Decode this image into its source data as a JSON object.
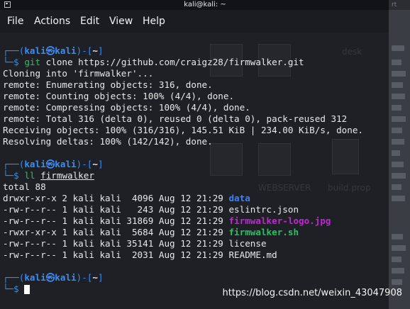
{
  "window": {
    "title": "kali@kali: ~",
    "side_fragment": "rt"
  },
  "menu": {
    "items": [
      "File",
      "Actions",
      "Edit",
      "View",
      "Help"
    ]
  },
  "background_labels": {
    "webserver": "WEBSERVER",
    "build": "build.prop",
    "desk": "desk"
  },
  "prompt": {
    "frame_open": "┌──(",
    "user": "kali",
    "at": "㉿",
    "host": "kali",
    "frame_mid": ")-[",
    "dir": "~",
    "frame_close": "]",
    "frame_bottom": "└─",
    "dollar": "$ "
  },
  "session": {
    "cmd1_verb": "git",
    "cmd1_args": " clone https://github.com/craigz28/firmwalker.git",
    "clone_output": [
      "Cloning into 'firmwalker'...",
      "remote: Enumerating objects: 316, done.",
      "remote: Counting objects: 100% (4/4), done.",
      "remote: Compressing objects: 100% (4/4), done.",
      "remote: Total 316 (delta 0), reused 0 (delta 0), pack-reused 312",
      "Receiving objects: 100% (316/316), 145.51 KiB | 234.00 KiB/s, done.",
      "Resolving deltas: 100% (142/142), done."
    ],
    "cmd2_verb": "ll",
    "cmd2_arg": "firmwalker",
    "total": "total 88",
    "ls_rows": [
      {
        "meta": "drwxr-xr-x 2 kali kali  4096 Aug 12 21:29 ",
        "name": "data",
        "kind": "dir"
      },
      {
        "meta": "-rw-r--r-- 1 kali kali   243 Aug 12 21:29 ",
        "name": "eslintrc.json",
        "kind": "file"
      },
      {
        "meta": "-rw-r--r-- 1 kali kali 31869 Aug 12 21:29 ",
        "name": "firmwalker-logo.jpg",
        "kind": "image"
      },
      {
        "meta": "-rwxr-xr-x 1 kali kali  5684 Aug 12 21:29 ",
        "name": "firmwalker.sh",
        "kind": "exec"
      },
      {
        "meta": "-rw-r--r-- 1 kali kali 35141 Aug 12 21:29 ",
        "name": "license",
        "kind": "file"
      },
      {
        "meta": "-rw-r--r-- 1 kali kali  2031 Aug 12 21:29 ",
        "name": "README.md",
        "kind": "file"
      }
    ]
  },
  "watermark": "https://blog.csdn.net/weixin_43047908",
  "colors": {
    "prompt_frame": "#2f8ff0",
    "command": "#22c55e",
    "dir_listing": "#3b82f6",
    "image_listing": "#c026d3",
    "exec_listing": "#22c55e",
    "terminal_bg": "#1e2026"
  }
}
